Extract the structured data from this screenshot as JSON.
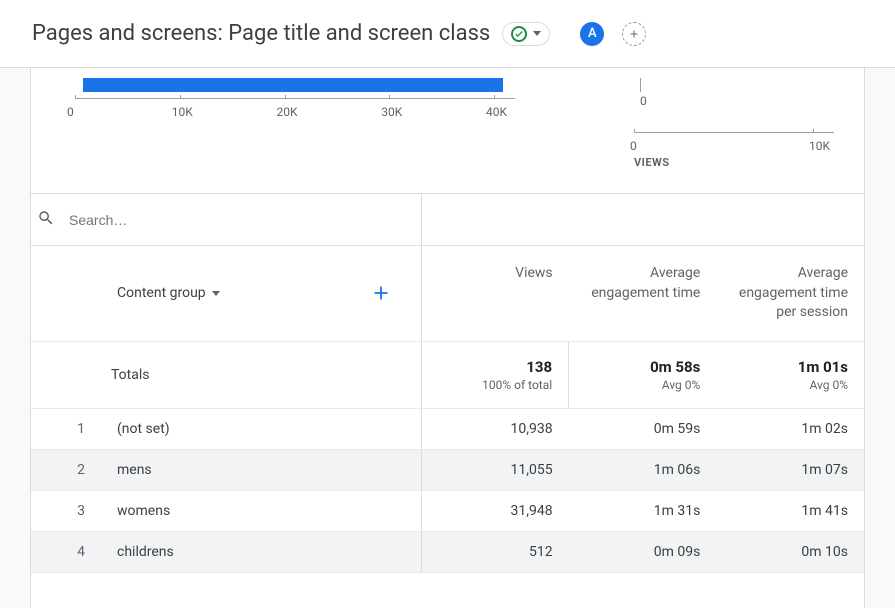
{
  "header": {
    "title": "Pages and screens: Page title and screen class",
    "avatar_letter": "A"
  },
  "chart_data": [
    {
      "type": "bar",
      "orientation": "horizontal",
      "xticks": [
        "0",
        "10K",
        "20K",
        "30K",
        "40K"
      ],
      "xlim": [
        0,
        40000
      ]
    },
    {
      "type": "bar",
      "yzero": "0",
      "xticks": [
        "0",
        "10K"
      ],
      "xlabel": "VIEWS"
    }
  ],
  "search": {
    "placeholder": "Search…"
  },
  "table": {
    "dimension_label": "Content group",
    "columns": [
      "Views",
      "Average engagement time",
      "Average engagement time per session"
    ],
    "totals_label": "Totals",
    "totals": {
      "views": {
        "main": "138",
        "sub": "100% of total"
      },
      "aet": {
        "main": "0m 58s",
        "sub": "Avg 0%"
      },
      "aeps": {
        "main": "1m 01s",
        "sub": "Avg 0%"
      }
    },
    "rows": [
      {
        "rank": "1",
        "dim": "(not set)",
        "views": "10,938",
        "aet": "0m 59s",
        "aeps": "1m 02s"
      },
      {
        "rank": "2",
        "dim": "mens",
        "views": "11,055",
        "aet": "1m 06s",
        "aeps": "1m 07s"
      },
      {
        "rank": "3",
        "dim": "womens",
        "views": "31,948",
        "aet": "1m 31s",
        "aeps": "1m 41s"
      },
      {
        "rank": "4",
        "dim": "childrens",
        "views": "512",
        "aet": "0m 09s",
        "aeps": "0m 10s"
      }
    ]
  }
}
